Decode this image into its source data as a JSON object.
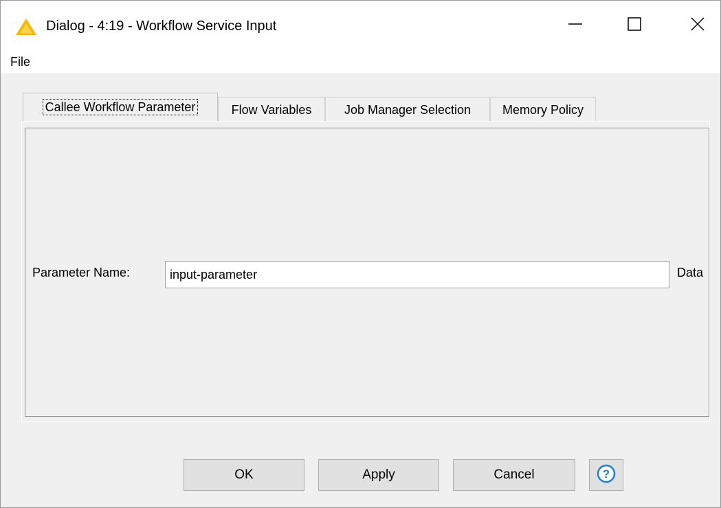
{
  "window": {
    "title": "Dialog - 4:19 - Workflow Service Input",
    "icon": "warning-triangle-icon",
    "controls": [
      "minimize-icon",
      "maximize-icon",
      "close-icon"
    ]
  },
  "menu": {
    "items": [
      "File"
    ]
  },
  "tabs": [
    {
      "label": "Callee Workflow Parameter",
      "active": true
    },
    {
      "label": "Flow Variables",
      "active": false
    },
    {
      "label": "Job Manager Selection",
      "active": false
    },
    {
      "label": "Memory Policy",
      "active": false
    }
  ],
  "form": {
    "parameter_label": "Parameter Name:",
    "parameter_value": "input-parameter",
    "trailing_label": "Data"
  },
  "buttons": {
    "ok": "OK",
    "apply": "Apply",
    "cancel": "Cancel",
    "help_icon": "help-icon"
  },
  "colors": {
    "icon_yellow": "#f5b800",
    "help_blue": "#1e7fd6"
  }
}
